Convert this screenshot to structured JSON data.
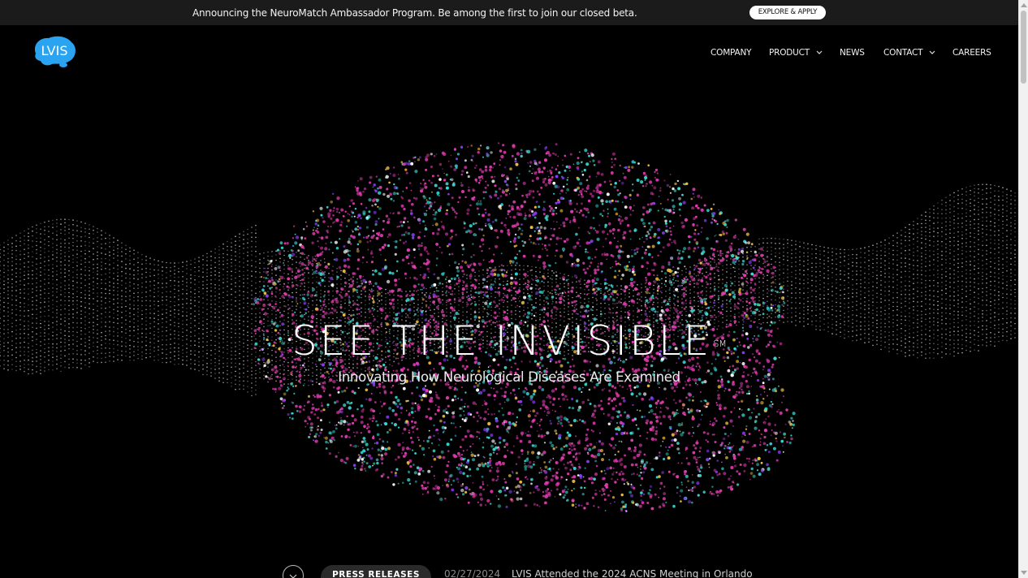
{
  "announcement": {
    "text": "Announcing the NeuroMatch Ambassador Program. Be among the first to join our closed beta.",
    "button_label": "EXPLORE & APPLY"
  },
  "logo": {
    "text": "LVIS",
    "color": "#2aa3f0"
  },
  "nav": {
    "company": "COMPANY",
    "product": "PRODUCT",
    "news": "NEWS",
    "contact": "CONTACT",
    "careers": "CAREERS"
  },
  "hero": {
    "title": "SEE THE INVISIBLE",
    "title_mark": "SM",
    "subtitle": "Innovating How Neurological Diseases Are Examined"
  },
  "news_ticker": {
    "category": "PRESS RELEASES",
    "date": "02/27/2024",
    "headline": "LVIS Attended the 2024 ACNS Meeting in Orlando"
  },
  "colors": {
    "background": "#000000",
    "particle_teal": "#3ad6d0",
    "particle_magenta": "#e23bb0",
    "particle_violet": "#8a3cf0"
  }
}
